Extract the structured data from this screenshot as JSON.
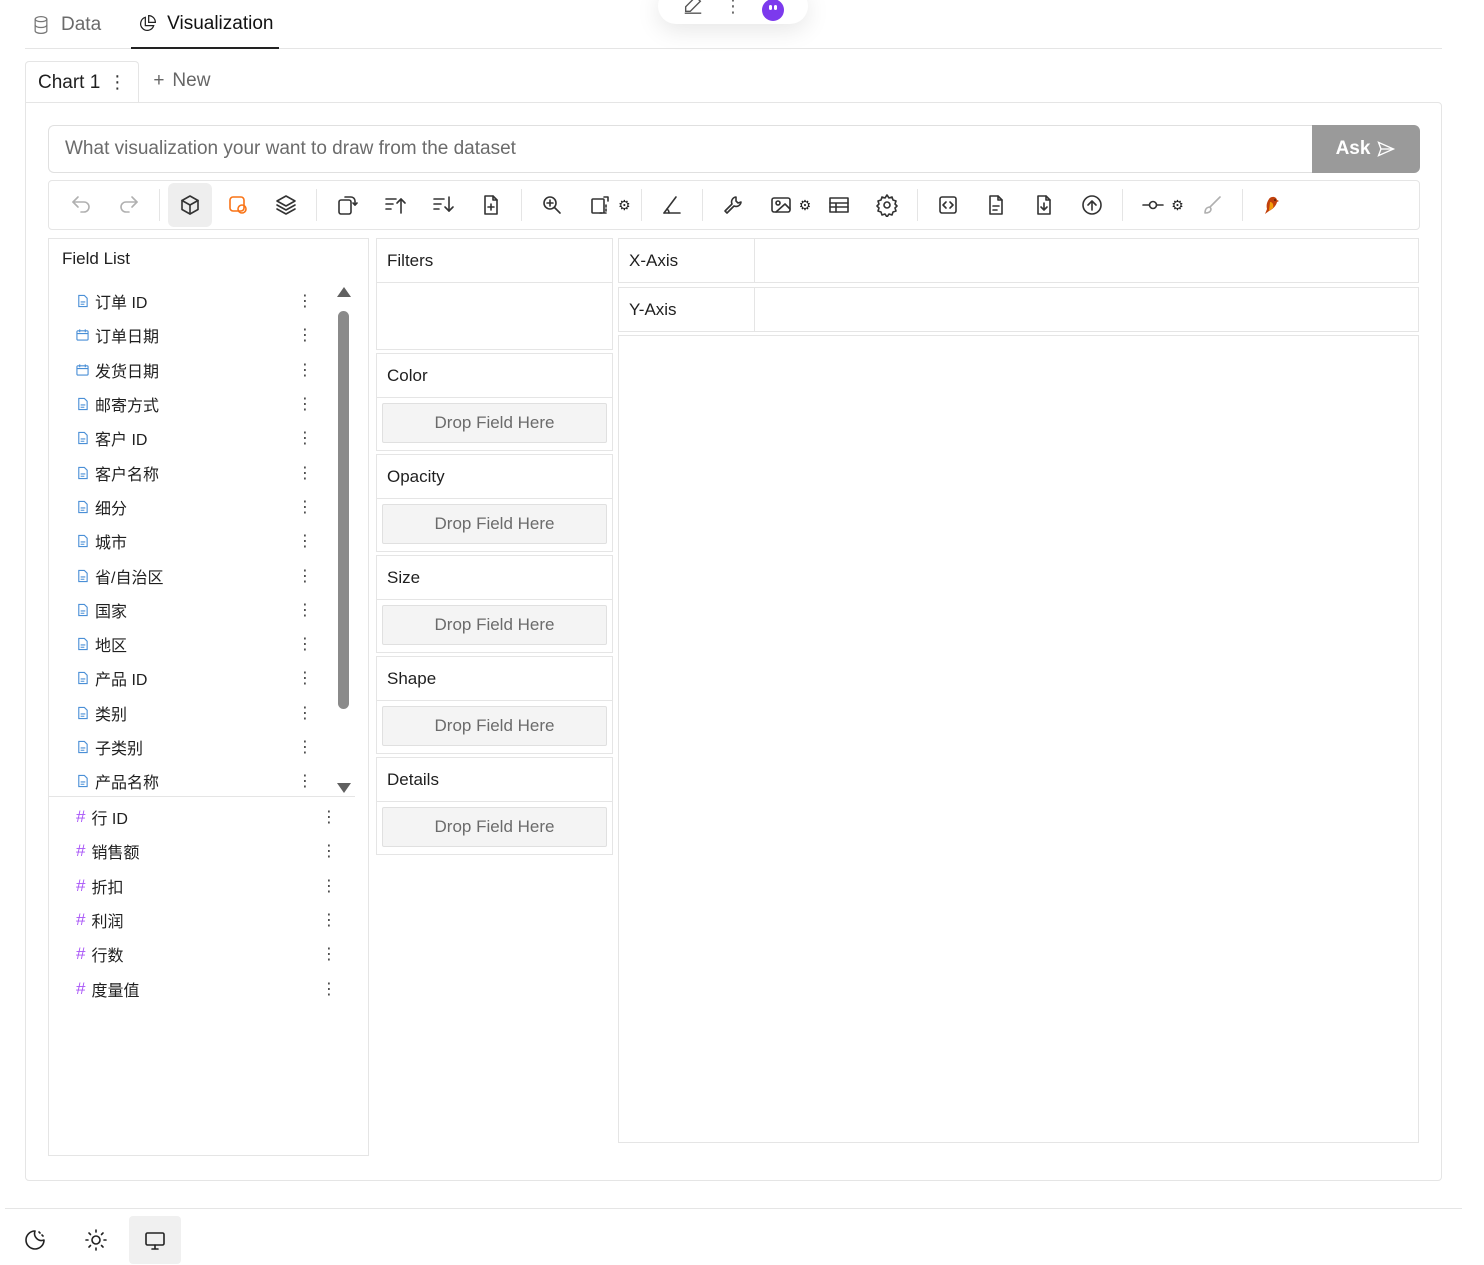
{
  "top_tabs": [
    {
      "label": "Data",
      "icon": "database-icon",
      "active": false
    },
    {
      "label": "Visualization",
      "icon": "pie-chart-icon",
      "active": true
    }
  ],
  "chart_tabs": {
    "items": [
      {
        "label": "Chart 1"
      }
    ],
    "new_label": "New"
  },
  "ask": {
    "placeholder": "What visualization your want to draw from the dataset",
    "button_label": "Ask"
  },
  "toolbar": {
    "buttons": [
      "undo-icon",
      "redo-icon",
      "cube-icon",
      "lasso-icon",
      "layers-icon",
      "transpose-icon",
      "sort-ascending-icon",
      "sort-descending-icon",
      "add-file-icon",
      "zoom-in-icon",
      "resize-icon",
      "measure-icon",
      "wrench-icon",
      "image-icon",
      "table-icon",
      "settings-icon",
      "code-icon",
      "document-icon",
      "download-icon",
      "upload-icon",
      "commit-icon",
      "brush-icon",
      "logo-bird-icon"
    ]
  },
  "field_list": {
    "title": "Field List",
    "dimensions": [
      {
        "name": "订单 ID",
        "type": "text"
      },
      {
        "name": "订单日期",
        "type": "date"
      },
      {
        "name": "发货日期",
        "type": "date"
      },
      {
        "name": "邮寄方式",
        "type": "text"
      },
      {
        "name": "客户 ID",
        "type": "text"
      },
      {
        "name": "客户名称",
        "type": "text"
      },
      {
        "name": "细分",
        "type": "text"
      },
      {
        "name": "城市",
        "type": "text"
      },
      {
        "name": "省/自治区",
        "type": "text"
      },
      {
        "name": "国家",
        "type": "text"
      },
      {
        "name": "地区",
        "type": "text"
      },
      {
        "name": "产品 ID",
        "type": "text"
      },
      {
        "name": "类别",
        "type": "text"
      },
      {
        "name": "子类别",
        "type": "text"
      },
      {
        "name": "产品名称",
        "type": "text"
      }
    ],
    "measures": [
      {
        "name": "行 ID"
      },
      {
        "name": "销售额"
      },
      {
        "name": "折扣"
      },
      {
        "name": "利润"
      },
      {
        "name": "行数"
      },
      {
        "name": "度量值"
      }
    ]
  },
  "encodings": {
    "filters": "Filters",
    "color": "Color",
    "opacity": "Opacity",
    "size": "Size",
    "shape": "Shape",
    "details": "Details",
    "drop_text": "Drop Field Here"
  },
  "axes": {
    "x": "X-Axis",
    "y": "Y-Axis"
  },
  "theme_buttons": [
    "dark-mode-icon",
    "light-mode-icon",
    "system-mode-icon"
  ],
  "colors": {
    "accent": "#f97316",
    "measure_hash": "#a855f7",
    "dimension_icon": "#4a8fd6",
    "ask_button": "#9a9a9a"
  }
}
